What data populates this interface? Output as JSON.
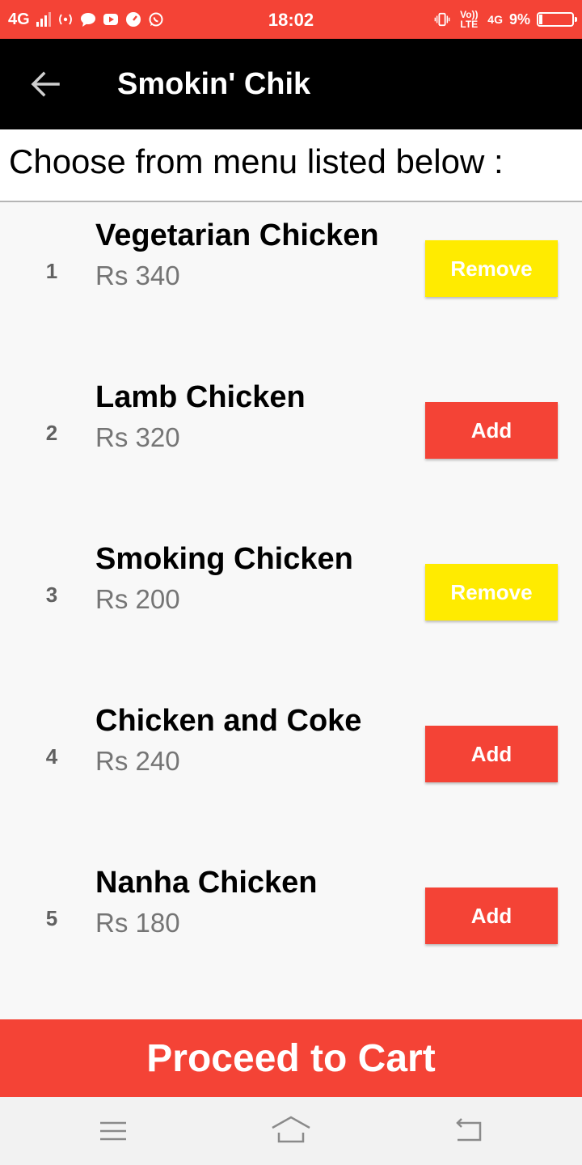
{
  "status_bar": {
    "network": "4G",
    "time": "18:02",
    "volte": "Vo)) LTE",
    "network2": "4G",
    "battery": "9%",
    "battery_level": 0.09,
    "icons": [
      "signal-bars-icon",
      "hotspot-icon",
      "chat-icon",
      "youtube-icon",
      "speedometer-icon",
      "whatsapp-icon",
      "vibrate-icon"
    ]
  },
  "app_bar": {
    "title": "Smokin' Chik",
    "back_icon": "arrow-left-icon"
  },
  "header": {
    "text": "Choose from menu listed below :"
  },
  "menu": {
    "items": [
      {
        "number": "1",
        "name": "Vegetarian Chicken",
        "price": "Rs 340",
        "button": "Remove",
        "state": "remove"
      },
      {
        "number": "2",
        "name": "Lamb Chicken",
        "price": "Rs 320",
        "button": "Add",
        "state": "add"
      },
      {
        "number": "3",
        "name": "Smoking Chicken",
        "price": "Rs 200",
        "button": "Remove",
        "state": "remove"
      },
      {
        "number": "4",
        "name": "Chicken and Coke",
        "price": "Rs 240",
        "button": "Add",
        "state": "add"
      },
      {
        "number": "5",
        "name": "Nanha Chicken",
        "price": "Rs 180",
        "button": "Add",
        "state": "add"
      }
    ]
  },
  "proceed": {
    "label": "Proceed to Cart"
  },
  "nav_bar": {
    "icons": [
      "menu-icon",
      "home-icon",
      "back-icon"
    ]
  },
  "colors": {
    "accent": "#f44336",
    "remove": "#ffeb00",
    "app_bar": "#000000"
  }
}
